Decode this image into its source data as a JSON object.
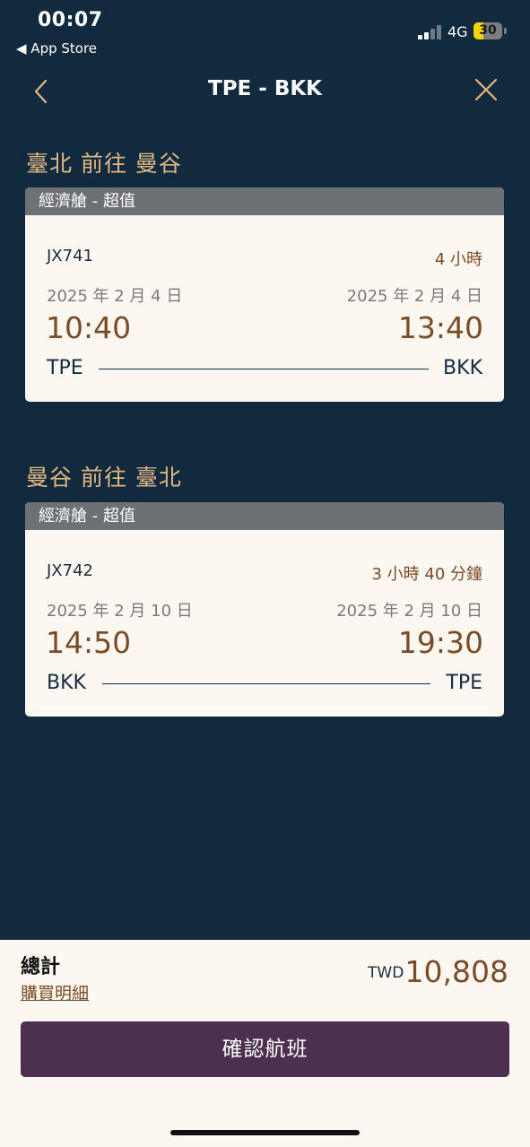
{
  "status_bar": {
    "time": "00:07",
    "back_app": "◀ App Store",
    "network": "4G",
    "battery": "30"
  },
  "nav": {
    "title": "TPE - BKK"
  },
  "outbound": {
    "route_title": "臺北 前往 曼谷",
    "cabin": "經濟艙 - 超值",
    "flight_no": "JX741",
    "duration": "4 小時",
    "dep_date": "2025 年 2 月 4 日",
    "arr_date": "2025 年 2 月 4 日",
    "dep_time": "10:40",
    "arr_time": "13:40",
    "dep_code": "TPE",
    "arr_code": "BKK"
  },
  "return": {
    "route_title": "曼谷 前往 臺北",
    "cabin": "經濟艙 - 超值",
    "flight_no": "JX742",
    "duration": "3 小時 40 分鐘",
    "dep_date": "2025 年 2 月 10 日",
    "arr_date": "2025 年 2 月 10 日",
    "dep_time": "14:50",
    "arr_time": "19:30",
    "dep_code": "BKK",
    "arr_code": "TPE"
  },
  "footer": {
    "total_label": "總計",
    "detail_link": "購買明細",
    "currency": "TWD",
    "price": "10,808",
    "confirm_label": "確認航班"
  },
  "colors": {
    "background": "#122a3d",
    "accent_gold": "#e0b784",
    "accent_brown": "#7b4b25",
    "button_purple": "#4d2f4f",
    "card_header": "#6d7176",
    "card_body": "#fcf7f1"
  }
}
